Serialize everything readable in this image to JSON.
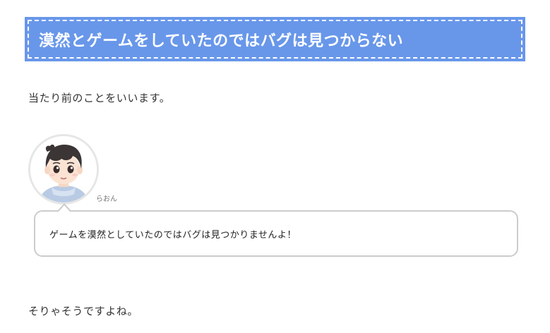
{
  "heading": {
    "text": "漠然とゲームをしていたのではバグは見つからない",
    "background_color": "#6897ea",
    "text_color": "#ffffff"
  },
  "paragraphs": [
    "当たり前のことをいいます。",
    "そりゃそうですよね。"
  ],
  "speech": {
    "speaker_name": "らおん",
    "avatar_icon": "boy-character-avatar",
    "text": "ゲームを漠然としていたのではバグは見つかりませんよ！",
    "border_color": "#cccccc"
  }
}
